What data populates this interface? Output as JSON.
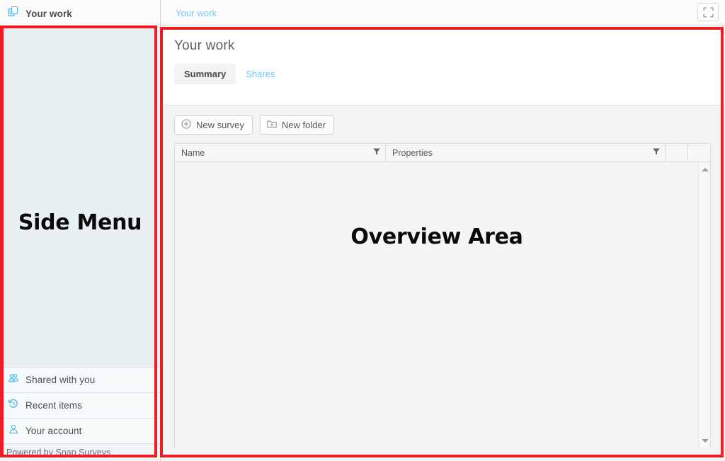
{
  "sidebar": {
    "header": {
      "label": "Your work",
      "icon": "copy-pages-icon"
    },
    "annotation": "Side Menu",
    "items": [
      {
        "label": "Shared with you",
        "icon": "shared-users-icon"
      },
      {
        "label": "Recent items",
        "icon": "recent-clock-icon"
      },
      {
        "label": "Your account",
        "icon": "user-account-icon"
      }
    ],
    "footer": "Powered by Snap Surveys"
  },
  "topbar": {
    "breadcrumb": "Your work",
    "expand_icon": "fullscreen-expand-icon"
  },
  "main": {
    "title": "Your work",
    "annotation": "Overview Area",
    "tabs": [
      {
        "label": "Summary",
        "active": true
      },
      {
        "label": "Shares",
        "active": false
      }
    ],
    "toolbar": [
      {
        "label": "New survey",
        "icon": "circle-plus-icon"
      },
      {
        "label": "New folder",
        "icon": "folder-plus-icon"
      }
    ],
    "grid": {
      "columns": [
        {
          "label": "Name",
          "filter_icon": "funnel-filter-icon"
        },
        {
          "label": "Properties",
          "filter_icon": "funnel-filter-icon"
        },
        {
          "label": "",
          "filter_icon": ""
        },
        {
          "label": "",
          "filter_icon": ""
        }
      ],
      "rows": []
    }
  },
  "colors": {
    "annotation_red": "#ee1c25",
    "link_blue": "#6ec6ef",
    "sidebar_bg": "#e9f0f3"
  }
}
